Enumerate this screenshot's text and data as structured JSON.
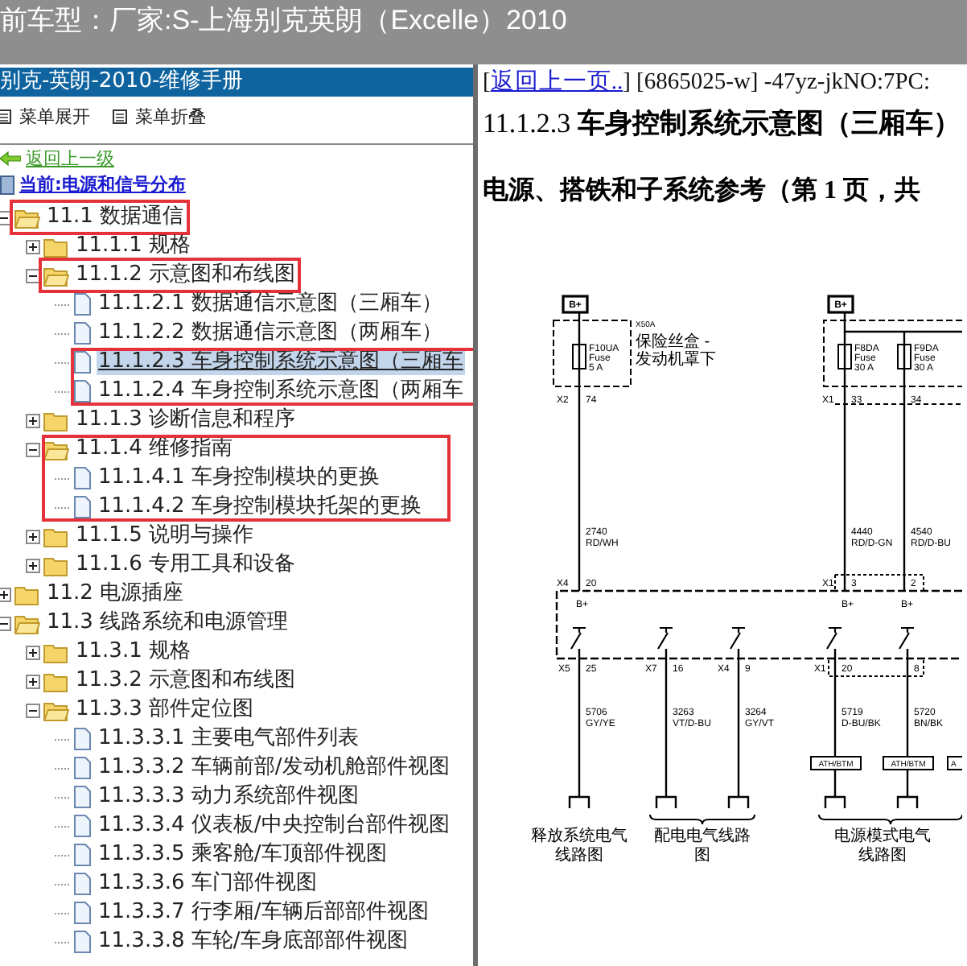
{
  "window": {
    "title": "前车型：厂家:S-上海别克英朗（Excelle）2010"
  },
  "sidebar": {
    "header": "别克-英朗-2010-维修手册",
    "toolbar": [
      {
        "label": "菜单展开"
      },
      {
        "label": "菜单折叠"
      }
    ],
    "back_link": "返回上一级",
    "current": "当前:电源和信号分布"
  },
  "tree": {
    "items": [
      {
        "kind": "folder",
        "label": "11.1 数据通信",
        "expanded": true,
        "boxed": true,
        "children": [
          {
            "kind": "folder",
            "label": "11.1.1 规格",
            "expanded": false,
            "boxed": false
          },
          {
            "kind": "folder",
            "label": "11.1.2 示意图和布线图",
            "expanded": true,
            "boxed": true,
            "children": [
              {
                "kind": "page",
                "label": "11.1.2.1 数据通信示意图（三厢车）",
                "selected": false,
                "boxed": false
              },
              {
                "kind": "page",
                "label": "11.1.2.2 数据通信示意图（两厢车）",
                "selected": false,
                "boxed": false
              },
              {
                "kind": "page",
                "label": "11.1.2.3 车身控制系统示意图（三厢车",
                "selected": true,
                "boxed": true
              },
              {
                "kind": "page",
                "label": "11.1.2.4 车身控制系统示意图（两厢车",
                "selected": false,
                "boxed": true
              }
            ]
          },
          {
            "kind": "folder",
            "label": "11.1.3 诊断信息和程序",
            "expanded": false,
            "boxed": false
          },
          {
            "kind": "folder",
            "label": "11.1.4 维修指南",
            "expanded": true,
            "boxed": true,
            "children": [
              {
                "kind": "page",
                "label": "11.1.4.1 车身控制模块的更换",
                "selected": false,
                "boxed": true
              },
              {
                "kind": "page",
                "label": "11.1.4.2 车身控制模块托架的更换",
                "selected": false,
                "boxed": true
              }
            ]
          },
          {
            "kind": "folder",
            "label": "11.1.5 说明与操作",
            "expanded": false,
            "boxed": false
          },
          {
            "kind": "folder",
            "label": "11.1.6 专用工具和设备",
            "expanded": false
          }
        ]
      },
      {
        "kind": "folder",
        "label": "11.2 电源插座",
        "expanded": false
      },
      {
        "kind": "folder",
        "label": "11.3 线路系统和电源管理",
        "expanded": true,
        "children": [
          {
            "kind": "folder",
            "label": "11.3.1 规格",
            "expanded": false
          },
          {
            "kind": "folder",
            "label": "11.3.2 示意图和布线图",
            "expanded": false
          },
          {
            "kind": "folder",
            "label": "11.3.3 部件定位图",
            "expanded": true,
            "children": [
              {
                "kind": "page",
                "label": "11.3.3.1 主要电气部件列表",
                "selected": false
              },
              {
                "kind": "page",
                "label": "11.3.3.2 车辆前部/发动机舱部件视图",
                "selected": false
              },
              {
                "kind": "page",
                "label": "11.3.3.3 动力系统部件视图",
                "selected": false
              },
              {
                "kind": "page",
                "label": "11.3.3.4 仪表板/中央控制台部件视图",
                "selected": false
              },
              {
                "kind": "page",
                "label": "11.3.3.5 乘客舱/车顶部件视图",
                "selected": false
              },
              {
                "kind": "page",
                "label": "11.3.3.6 车门部件视图",
                "selected": false
              },
              {
                "kind": "page",
                "label": "11.3.3.7 行李厢/车辆后部部件视图",
                "selected": false
              },
              {
                "kind": "page",
                "label": "11.3.3.8 车轮/车身底部部件视图",
                "selected": false
              }
            ]
          }
        ]
      }
    ]
  },
  "document": {
    "link_prefix": "[",
    "back_link": "返回上一页..",
    "reference": "] [6865025-w] -47yz-jkNO:7PC:",
    "title": "11.1.2.3 **车身控制系统示意图（三厢车）**",
    "subtitle": "电源、搭铁和子系统参考（第 1 页，共",
    "diagram": {
      "feeds": [
        {
          "supply": "B+",
          "note": [
            "X50A",
            "保险丝盒 -",
            "发动机罩下"
          ],
          "fuses": [
            {
              "name": "F10UA",
              "type": "Fuse",
              "rating": "5 A",
              "in_connector": "X2",
              "in_pin": "74",
              "circuit": "2740",
              "wire_color": "RD/WH",
              "out_connector": "X4",
              "out_pin": "20",
              "node": "B+"
            }
          ]
        },
        {
          "supply": "B+",
          "fuses": [
            {
              "name": "F8DA",
              "type": "Fuse",
              "rating": "30 A",
              "in_connector": "X1",
              "in_pin": "33",
              "circuit": "4440",
              "wire_color": "RD/D-GN",
              "out_connector": "X1",
              "out_pin": "3",
              "node": "B+"
            },
            {
              "name": "F9DA",
              "type": "Fuse",
              "rating": "30 A",
              "in_pin": "34",
              "circuit": "4540",
              "wire_color": "RD/D-BU",
              "out_pin": "2",
              "node": "B+"
            }
          ]
        }
      ],
      "extra_inline": "A",
      "references": [
        {
          "lines": [
            "释放系统电气",
            "线路图"
          ],
          "outputs": [
            {
              "connector": "X5",
              "pin": "25",
              "circuit": "5706",
              "wire_color": "GY/YE"
            }
          ]
        },
        {
          "lines": [
            "配电电气线路",
            "图"
          ],
          "outputs": [
            {
              "connector": "X7",
              "pin": "16",
              "circuit": "3263",
              "wire_color": "VT/D-BU"
            },
            {
              "connector": "X4",
              "pin": "9",
              "circuit": "3264",
              "wire_color": "GY/VT"
            }
          ]
        },
        {
          "lines": [
            "电源模式电气",
            "线路图"
          ],
          "outputs": [
            {
              "connector": "X1",
              "pin": "20",
              "circuit": "5719",
              "wire_color": "D-BU/BK",
              "inline": "ATH/BTM"
            },
            {
              "pin": "8",
              "circuit": "5720",
              "wire_color": "BN/BK",
              "inline": "ATH/BTM"
            }
          ]
        }
      ]
    }
  }
}
